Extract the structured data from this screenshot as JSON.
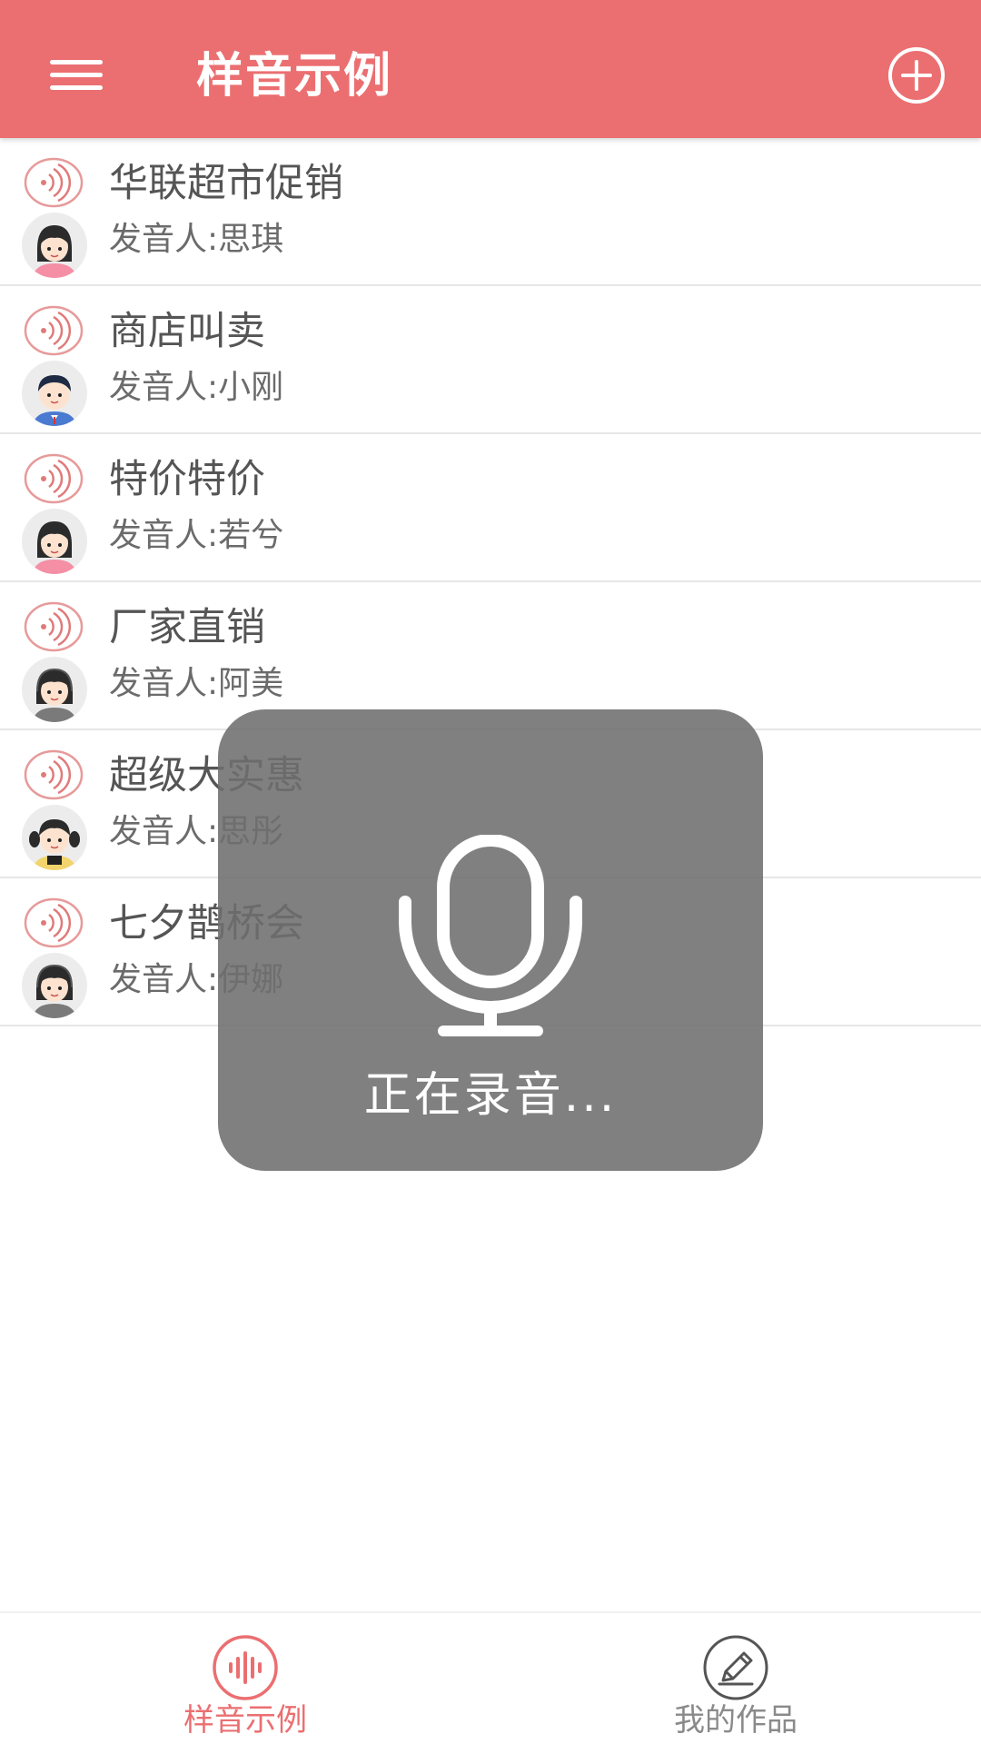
{
  "header": {
    "title": "样音示例",
    "menu_icon": "hamburger-menu-icon",
    "add_icon": "add-circle-icon"
  },
  "samples": [
    {
      "title": "华联超市促销",
      "speaker": "发音人:思琪",
      "avatar": "girl-pink-avatar"
    },
    {
      "title": "商店叫卖",
      "speaker": "发音人:小刚",
      "avatar": "boy-suit-avatar"
    },
    {
      "title": "特价特价",
      "speaker": "发音人:若兮",
      "avatar": "girl-pink-avatar"
    },
    {
      "title": "厂家直销",
      "speaker": "发音人:阿美",
      "avatar": "girl-headset-avatar"
    },
    {
      "title": "超级大实惠",
      "speaker": "发音人:思彤",
      "avatar": "girl-pigtails-avatar"
    },
    {
      "title": "七夕鹊桥会",
      "speaker": "发音人:伊娜",
      "avatar": "girl-headset-avatar"
    }
  ],
  "recording_overlay": {
    "label": "正在录音...",
    "icon": "microphone-icon"
  },
  "bottom_nav": {
    "tabs": [
      {
        "label": "样音示例",
        "icon": "sound-wave-icon",
        "active": true
      },
      {
        "label": "我的作品",
        "icon": "pencil-icon",
        "active": false
      }
    ]
  },
  "colors": {
    "accent": "#eb6f71",
    "inactive": "#8a8a8a",
    "overlay": "#6e6e6e"
  }
}
